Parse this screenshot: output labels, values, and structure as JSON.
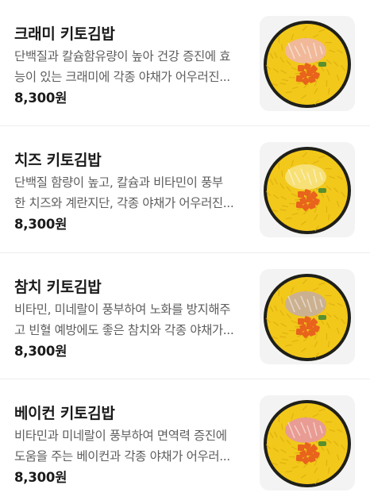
{
  "menu": {
    "items": [
      {
        "name": "크래미 키토김밥",
        "desc_line1": "단백질과 칼슘함유량이 높아 건강 증진에 효",
        "desc_line2": "능이 있는 크래미에 각종 야채가 어우러진...",
        "price": "8,300원",
        "image_icon": "kimbap-crab-photo",
        "topping": "crab"
      },
      {
        "name": "치즈 키토김밥",
        "desc_line1": "단백질 함량이 높고, 칼슘과 비타민이 풍부",
        "desc_line2": "한 치즈와 계란지단, 각종 야채가 어우러진...",
        "price": "8,300원",
        "image_icon": "kimbap-cheese-photo",
        "topping": "cheese"
      },
      {
        "name": "참치 키토김밥",
        "desc_line1": "비타민, 미네랄이 풍부하여 노화를 방지해주",
        "desc_line2": "고 빈혈 예방에도 좋은 참치와 각종 야채가...",
        "price": "8,300원",
        "image_icon": "kimbap-tuna-photo",
        "topping": "tuna"
      },
      {
        "name": "베이컨 키토김밥",
        "desc_line1": "비타민과 미네랄이 풍부하여 면역력 증진에",
        "desc_line2": "도움을 주는 베이컨과 각종 야채가 어우러...",
        "price": "8,300원",
        "image_icon": "kimbap-bacon-photo",
        "topping": "bacon"
      }
    ]
  },
  "colors": {
    "egg": "#f2c81a",
    "egg_dark": "#d9a80c",
    "seaweed": "#1f1f1a",
    "carrot": "#e8631c",
    "crab": "#f0b8a0",
    "cheese": "#f7e27a",
    "tuna": "#c9b098",
    "bacon": "#e89a9a",
    "thumb_bg": "#f3f3f3"
  }
}
